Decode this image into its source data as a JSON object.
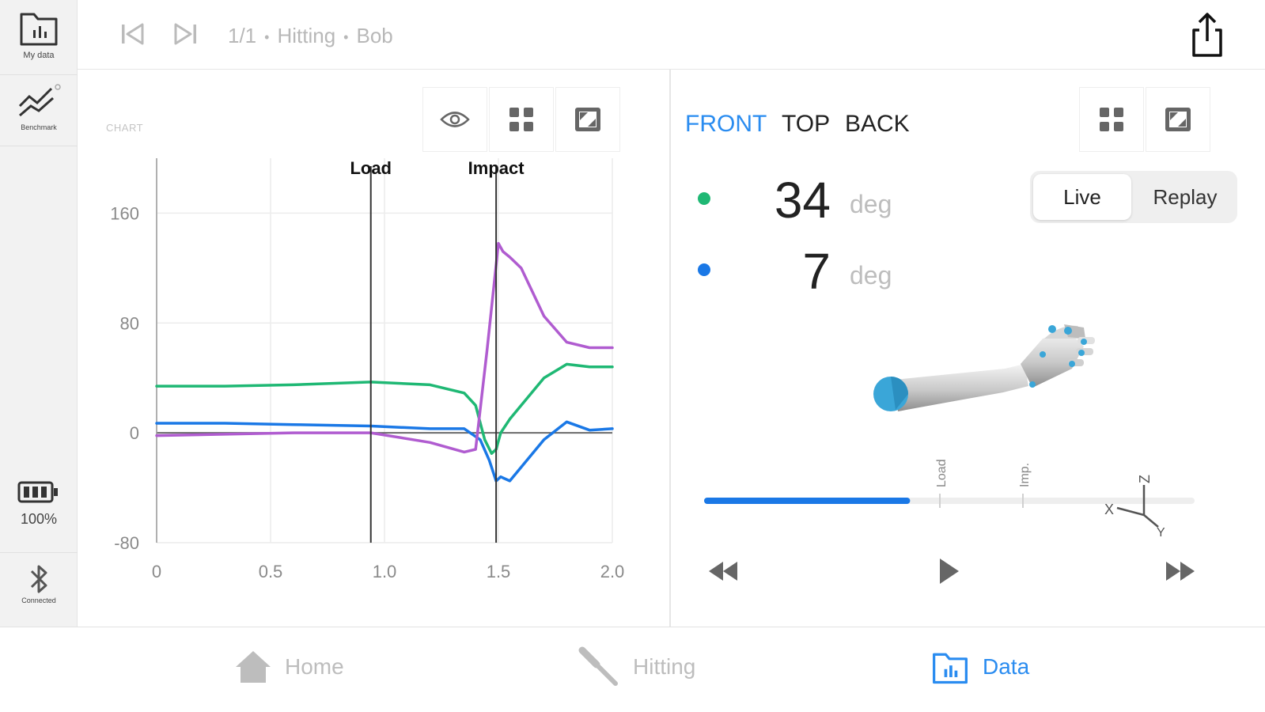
{
  "rail": {
    "my_data_label": "My data",
    "benchmark_label": "Benchmark",
    "battery_percent": "100%",
    "bluetooth_label": "Connected"
  },
  "topbar": {
    "position": "1/1",
    "activity": "Hitting",
    "athlete": "Bob"
  },
  "chart_panel": {
    "caption": "CHART"
  },
  "chart_data": {
    "type": "line",
    "xlim": [
      0,
      2.0
    ],
    "ylim": [
      -80,
      200
    ],
    "x_ticks": [
      "0",
      "0.5",
      "1.0",
      "1.5",
      "2.0"
    ],
    "y_ticks": [
      "160",
      "80",
      "0",
      "-80"
    ],
    "y_tick_values": [
      160,
      80,
      0,
      -80
    ],
    "x_tick_values": [
      0,
      0.5,
      1.0,
      1.5,
      2.0
    ],
    "markers": [
      {
        "label": "Load",
        "x": 0.94
      },
      {
        "label": "Impact",
        "x": 1.49
      }
    ],
    "series": [
      {
        "color": "#1fb874",
        "x": [
          0,
          0.3,
          0.6,
          0.94,
          1.2,
          1.35,
          1.4,
          1.44,
          1.47,
          1.49,
          1.51,
          1.55,
          1.6,
          1.7,
          1.8,
          1.9,
          2.0
        ],
        "y": [
          34,
          34,
          35,
          37,
          35,
          29,
          20,
          -5,
          -15,
          -12,
          0,
          10,
          20,
          40,
          50,
          48,
          48
        ]
      },
      {
        "color": "#1a78e6",
        "x": [
          0,
          0.3,
          0.6,
          0.94,
          1.2,
          1.35,
          1.42,
          1.46,
          1.49,
          1.51,
          1.55,
          1.6,
          1.7,
          1.8,
          1.9,
          2.0
        ],
        "y": [
          7,
          7,
          6,
          5,
          3,
          3,
          -5,
          -20,
          -35,
          -32,
          -35,
          -25,
          -5,
          8,
          2,
          3
        ]
      },
      {
        "color": "#b05cd0",
        "x": [
          0,
          0.3,
          0.6,
          0.94,
          1.2,
          1.35,
          1.4,
          1.45,
          1.5,
          1.52,
          1.55,
          1.6,
          1.7,
          1.8,
          1.9,
          2.0
        ],
        "y": [
          -2,
          -1,
          0,
          0,
          -7,
          -14,
          -12,
          60,
          138,
          132,
          128,
          120,
          85,
          66,
          62,
          62
        ]
      }
    ]
  },
  "view_panel": {
    "tabs": [
      "FRONT",
      "TOP",
      "BACK"
    ],
    "active_tab": "FRONT",
    "readings": [
      {
        "color": "#1fb874",
        "value": "34",
        "unit": "deg"
      },
      {
        "color": "#1a78e6",
        "value": "7",
        "unit": "deg"
      }
    ],
    "mode_live": "Live",
    "mode_replay": "Replay",
    "timeline_marks": [
      "Load",
      "Imp."
    ],
    "playback_progress": 0.42,
    "axes_labels": [
      "X",
      "Z",
      "Y"
    ]
  },
  "bottom_nav": {
    "home": "Home",
    "hitting": "Hitting",
    "data": "Data",
    "active": "Data"
  }
}
